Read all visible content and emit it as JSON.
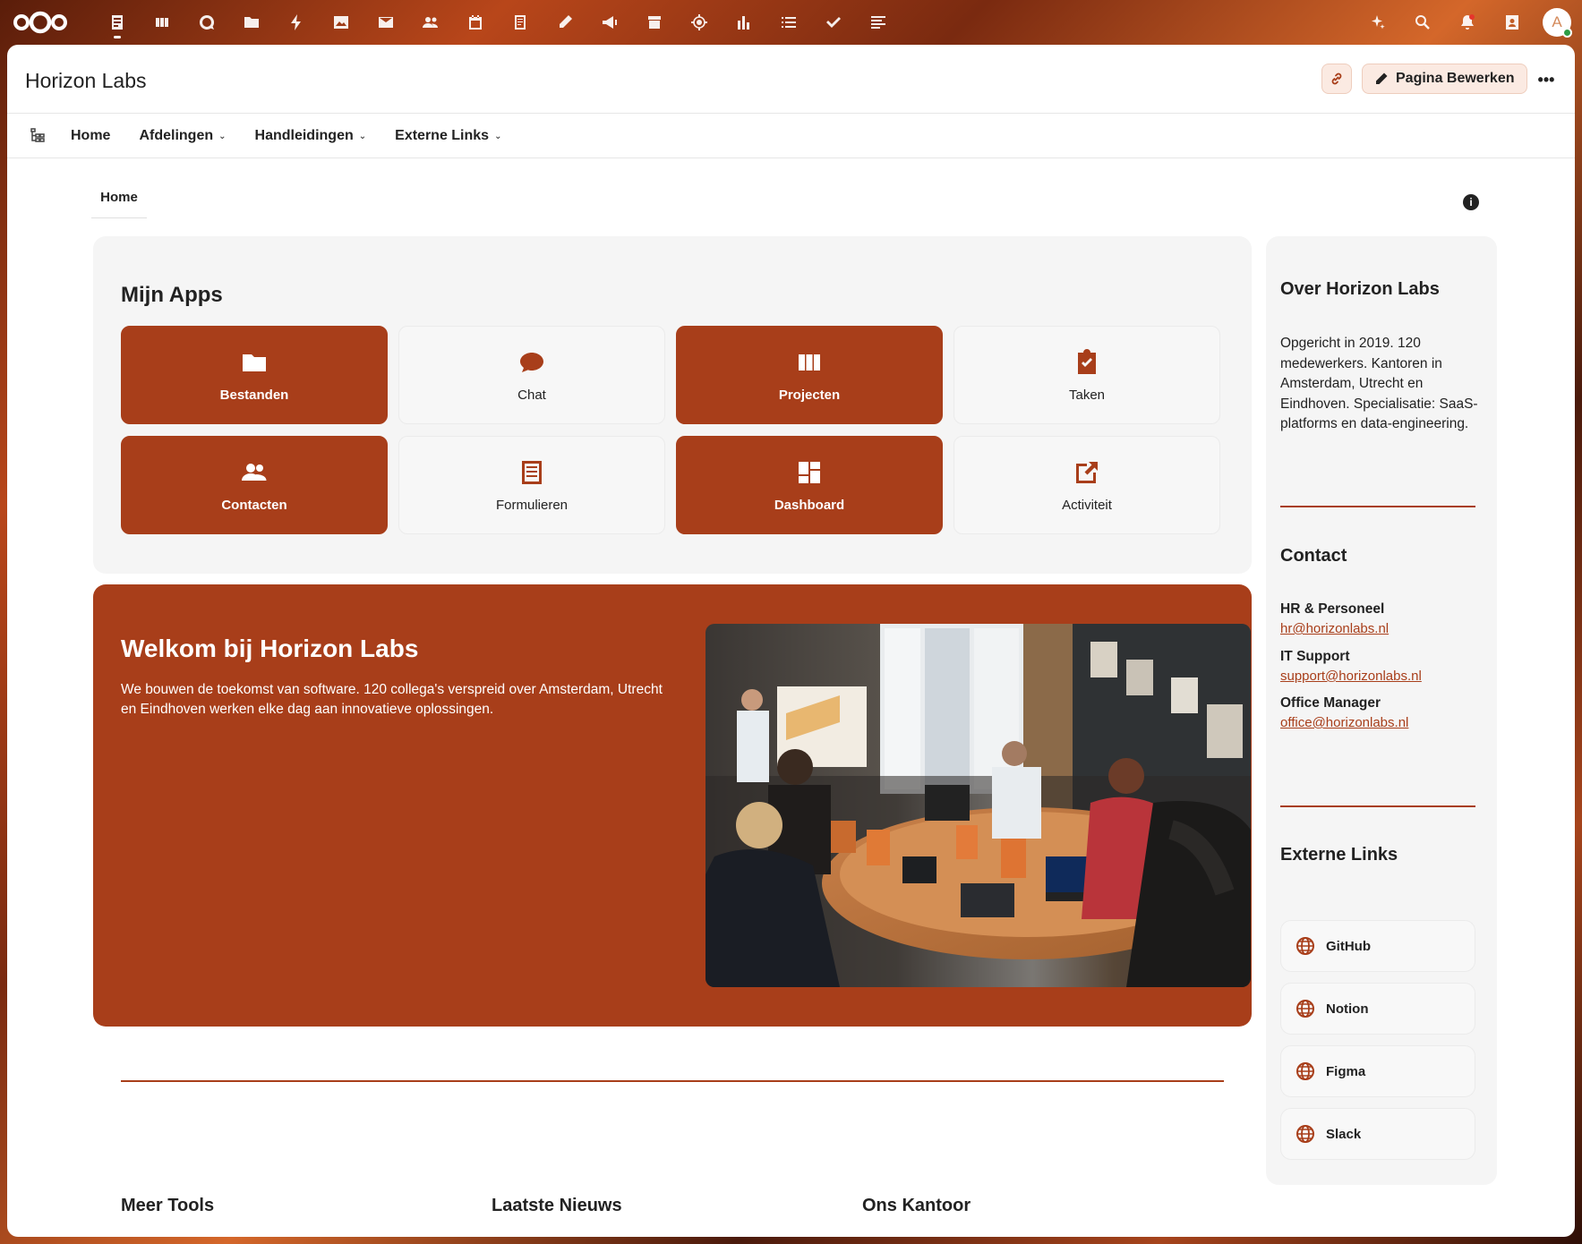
{
  "topbar": {
    "apps": [
      {
        "icon": "dashboard-icon",
        "active": true
      },
      {
        "icon": "deck-icon"
      },
      {
        "icon": "talk-icon"
      },
      {
        "icon": "files-icon"
      },
      {
        "icon": "activity-icon"
      },
      {
        "icon": "photos-icon"
      },
      {
        "icon": "mail-icon"
      },
      {
        "icon": "contacts-icon"
      },
      {
        "icon": "calendar-icon"
      },
      {
        "icon": "notes-icon"
      },
      {
        "icon": "whiteboard-icon"
      },
      {
        "icon": "announcements-icon"
      },
      {
        "icon": "archive-icon"
      },
      {
        "icon": "circles-icon"
      },
      {
        "icon": "analytics-icon"
      },
      {
        "icon": "lists-icon"
      },
      {
        "icon": "tasks-icon"
      },
      {
        "icon": "collectives-icon"
      }
    ],
    "right": [
      "assistant-icon",
      "search-icon",
      "notifications-icon",
      "contacts-menu-icon"
    ],
    "avatar_letter": "A",
    "accent": "#a83e1a"
  },
  "header": {
    "title": "Horizon Labs",
    "edit_label": "Pagina Bewerken"
  },
  "nav": {
    "items": [
      {
        "label": "Home",
        "dropdown": false
      },
      {
        "label": "Afdelingen",
        "dropdown": true
      },
      {
        "label": "Handleidingen",
        "dropdown": true
      },
      {
        "label": "Externe Links",
        "dropdown": true
      }
    ]
  },
  "breadcrumb": "Home",
  "apps": {
    "title": "Mijn Apps",
    "tiles": [
      {
        "label": "Bestanden",
        "icon": "folder-icon",
        "style": "dark"
      },
      {
        "label": "Chat",
        "icon": "chat-icon",
        "style": "light"
      },
      {
        "label": "Projecten",
        "icon": "deck-icon",
        "style": "dark"
      },
      {
        "label": "Taken",
        "icon": "clipboard-check-icon",
        "style": "light"
      },
      {
        "label": "Contacten",
        "icon": "people-icon",
        "style": "dark"
      },
      {
        "label": "Formulieren",
        "icon": "form-icon",
        "style": "light"
      },
      {
        "label": "Dashboard",
        "icon": "dashboard-grid-icon",
        "style": "dark"
      },
      {
        "label": "Activiteit",
        "icon": "open-external-icon",
        "style": "light"
      }
    ]
  },
  "welcome": {
    "title": "Welkom bij Horizon Labs",
    "text": "We bouwen de toekomst van software. 120 collega's verspreid over Amsterdam, Utrecht en Eindhoven werken elke dag aan innovatieve oplossingen."
  },
  "bottom_sections": [
    "Meer Tools",
    "Laatste Nieuws",
    "Ons Kantoor"
  ],
  "sidebar": {
    "about_title": "Over Horizon Labs",
    "about_text": "Opgericht in 2019. 120 medewerkers. Kantoren in Amsterdam, Utrecht en Eindhoven. Specialisatie: SaaS-platforms en data-engineering.",
    "contact_title": "Contact",
    "contacts": [
      {
        "label": "HR & Personeel",
        "email": "hr@horizonlabs.nl"
      },
      {
        "label": "IT Support",
        "email": "support@horizonlabs.nl"
      },
      {
        "label": "Office Manager",
        "email": "office@horizonlabs.nl"
      }
    ],
    "links_title": "Externe Links",
    "links": [
      "GitHub",
      "Notion",
      "Figma",
      "Slack"
    ]
  }
}
